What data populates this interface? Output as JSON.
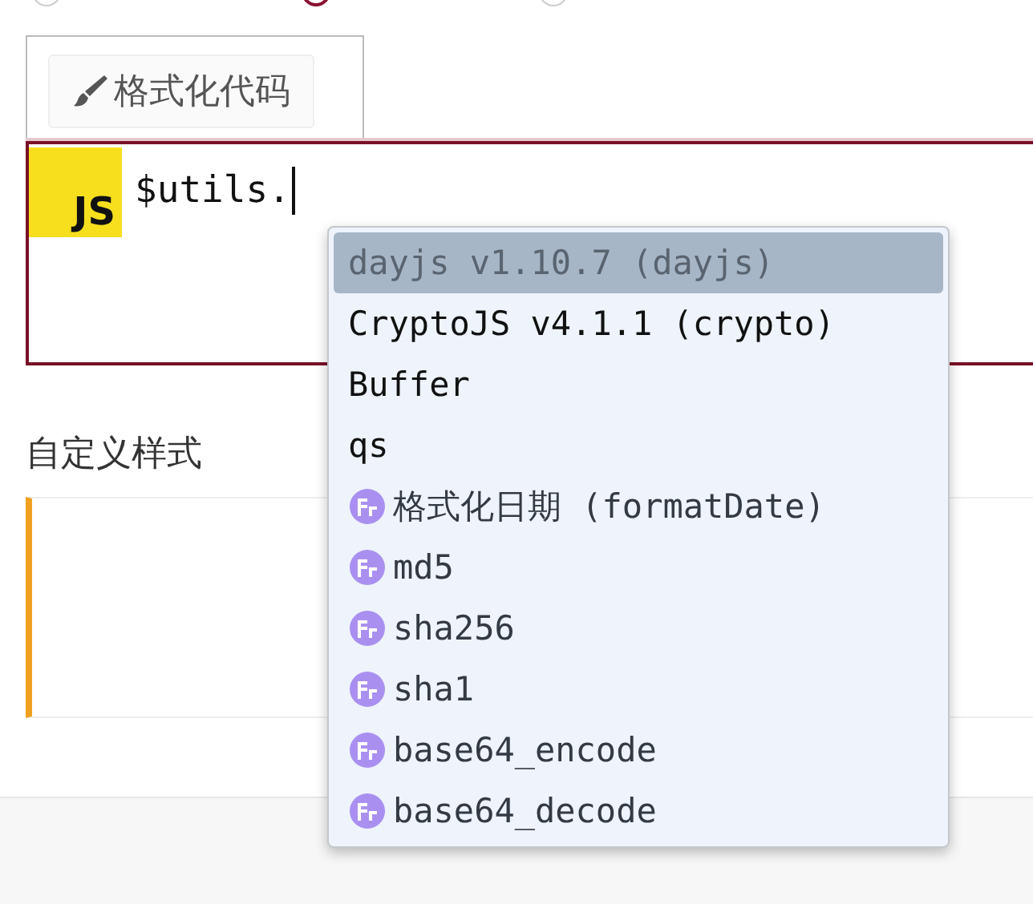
{
  "radios": [
    {
      "selected": false
    },
    {
      "selected": true
    },
    {
      "selected": false
    }
  ],
  "format_button": {
    "label": "格式化代码"
  },
  "editor": {
    "language_badge": "JS",
    "code": "$utils."
  },
  "autocomplete": [
    {
      "kind": "module",
      "label": "dayjs v1.10.7 (dayjs)",
      "selected": true
    },
    {
      "kind": "module",
      "label": "CryptoJS v4.1.1 (crypto)",
      "selected": false
    },
    {
      "kind": "module",
      "label": "Buffer",
      "selected": false
    },
    {
      "kind": "module",
      "label": "qs",
      "selected": false
    },
    {
      "kind": "function",
      "label": "格式化日期 (formatDate)",
      "selected": false
    },
    {
      "kind": "function",
      "label": "md5",
      "selected": false
    },
    {
      "kind": "function",
      "label": "sha256",
      "selected": false
    },
    {
      "kind": "function",
      "label": "sha1",
      "selected": false
    },
    {
      "kind": "function",
      "label": "base64_encode",
      "selected": false
    },
    {
      "kind": "function",
      "label": "base64_decode",
      "selected": false
    }
  ],
  "custom_style": {
    "title": "自定义样式"
  }
}
